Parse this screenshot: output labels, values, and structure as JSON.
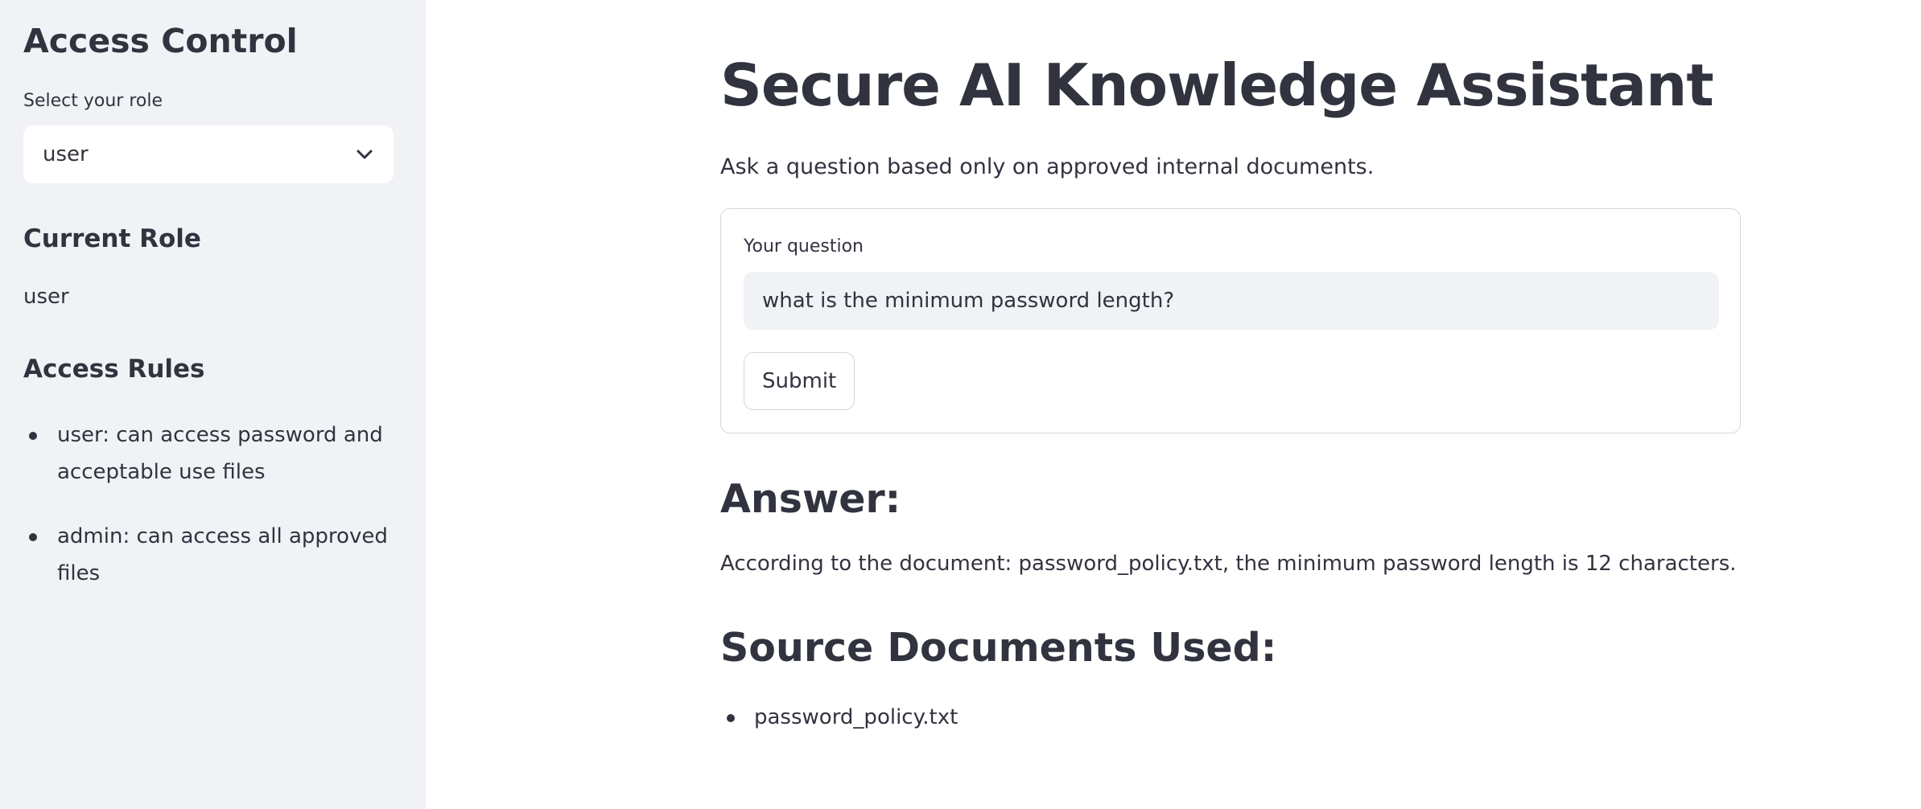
{
  "sidebar": {
    "title": "Access Control",
    "role_select": {
      "label": "Select your role",
      "value": "user",
      "icon": "chevron-down-icon"
    },
    "current_role": {
      "heading": "Current Role",
      "value": "user"
    },
    "access_rules": {
      "heading": "Access Rules",
      "items": [
        "user: can access password and acceptable use files",
        "admin: can access all approved files"
      ]
    }
  },
  "main": {
    "title": "Secure AI Knowledge Assistant",
    "subtitle": "Ask a question based only on approved internal documents.",
    "form": {
      "question_label": "Your question",
      "question_value": "what is the minimum password length?",
      "submit_label": "Submit"
    },
    "answer": {
      "heading": "Answer:",
      "text": "According to the document: password_policy.txt, the minimum password length is 12 characters."
    },
    "sources": {
      "heading": "Source Documents Used:",
      "items": [
        "password_policy.txt"
      ]
    }
  },
  "colors": {
    "sidebar_bg": "#f0f2f6",
    "text": "#31333f",
    "input_bg": "#f0f2f6",
    "border": "#d6d6d9"
  }
}
